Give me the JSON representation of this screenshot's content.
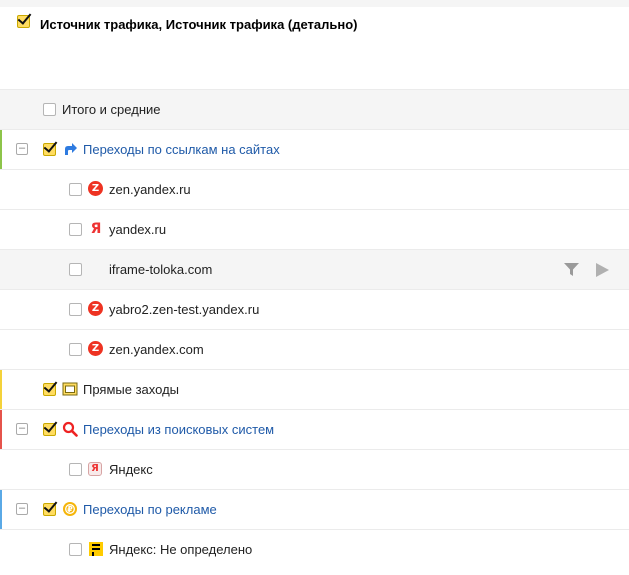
{
  "header": {
    "title": "Источник трафика, Источник трафика (детально)",
    "checked": true
  },
  "rows": [
    {
      "label": "Итого и средние",
      "checked": false,
      "icon": "none",
      "level": 0
    },
    {
      "label": "Переходы по ссылкам на сайтах",
      "checked": true,
      "icon": "link-arrow-icon",
      "level": 0,
      "link": true,
      "accent": "#8dc44a",
      "collapse": "–"
    },
    {
      "label": "zen.yandex.ru",
      "checked": false,
      "icon": "zen-icon",
      "level": 1
    },
    {
      "label": "yandex.ru",
      "checked": false,
      "icon": "yandex-icon",
      "level": 1
    },
    {
      "label": "iframe-toloka.com",
      "checked": false,
      "icon": "none",
      "level": 1,
      "hovered": true
    },
    {
      "label": "yabro2.zen-test.yandex.ru",
      "checked": false,
      "icon": "zen-icon",
      "level": 1
    },
    {
      "label": "zen.yandex.com",
      "checked": false,
      "icon": "zen-icon",
      "level": 1
    },
    {
      "label": "Прямые заходы",
      "checked": true,
      "icon": "browser-window-icon",
      "level": 0,
      "accent": "#f4d23a"
    },
    {
      "label": "Переходы из поисковых систем",
      "checked": true,
      "icon": "search-magnifier-icon",
      "level": 0,
      "link": true,
      "accent": "#e5534b",
      "collapse": "–"
    },
    {
      "label": "Яндекс",
      "checked": false,
      "icon": "yandex-box-icon",
      "level": 1
    },
    {
      "label": "Переходы по рекламе",
      "checked": true,
      "icon": "ad-coin-icon",
      "level": 0,
      "link": true,
      "accent": "#5aa9e6",
      "collapse": "–"
    },
    {
      "label": "Яндекс: Не определено",
      "checked": false,
      "icon": "yandex-direct-icon",
      "level": 1
    }
  ],
  "colors": {
    "checkbox_on": "#ffdc60",
    "link": "#1f5aa8",
    "hover_row": "#f5f5f5"
  }
}
